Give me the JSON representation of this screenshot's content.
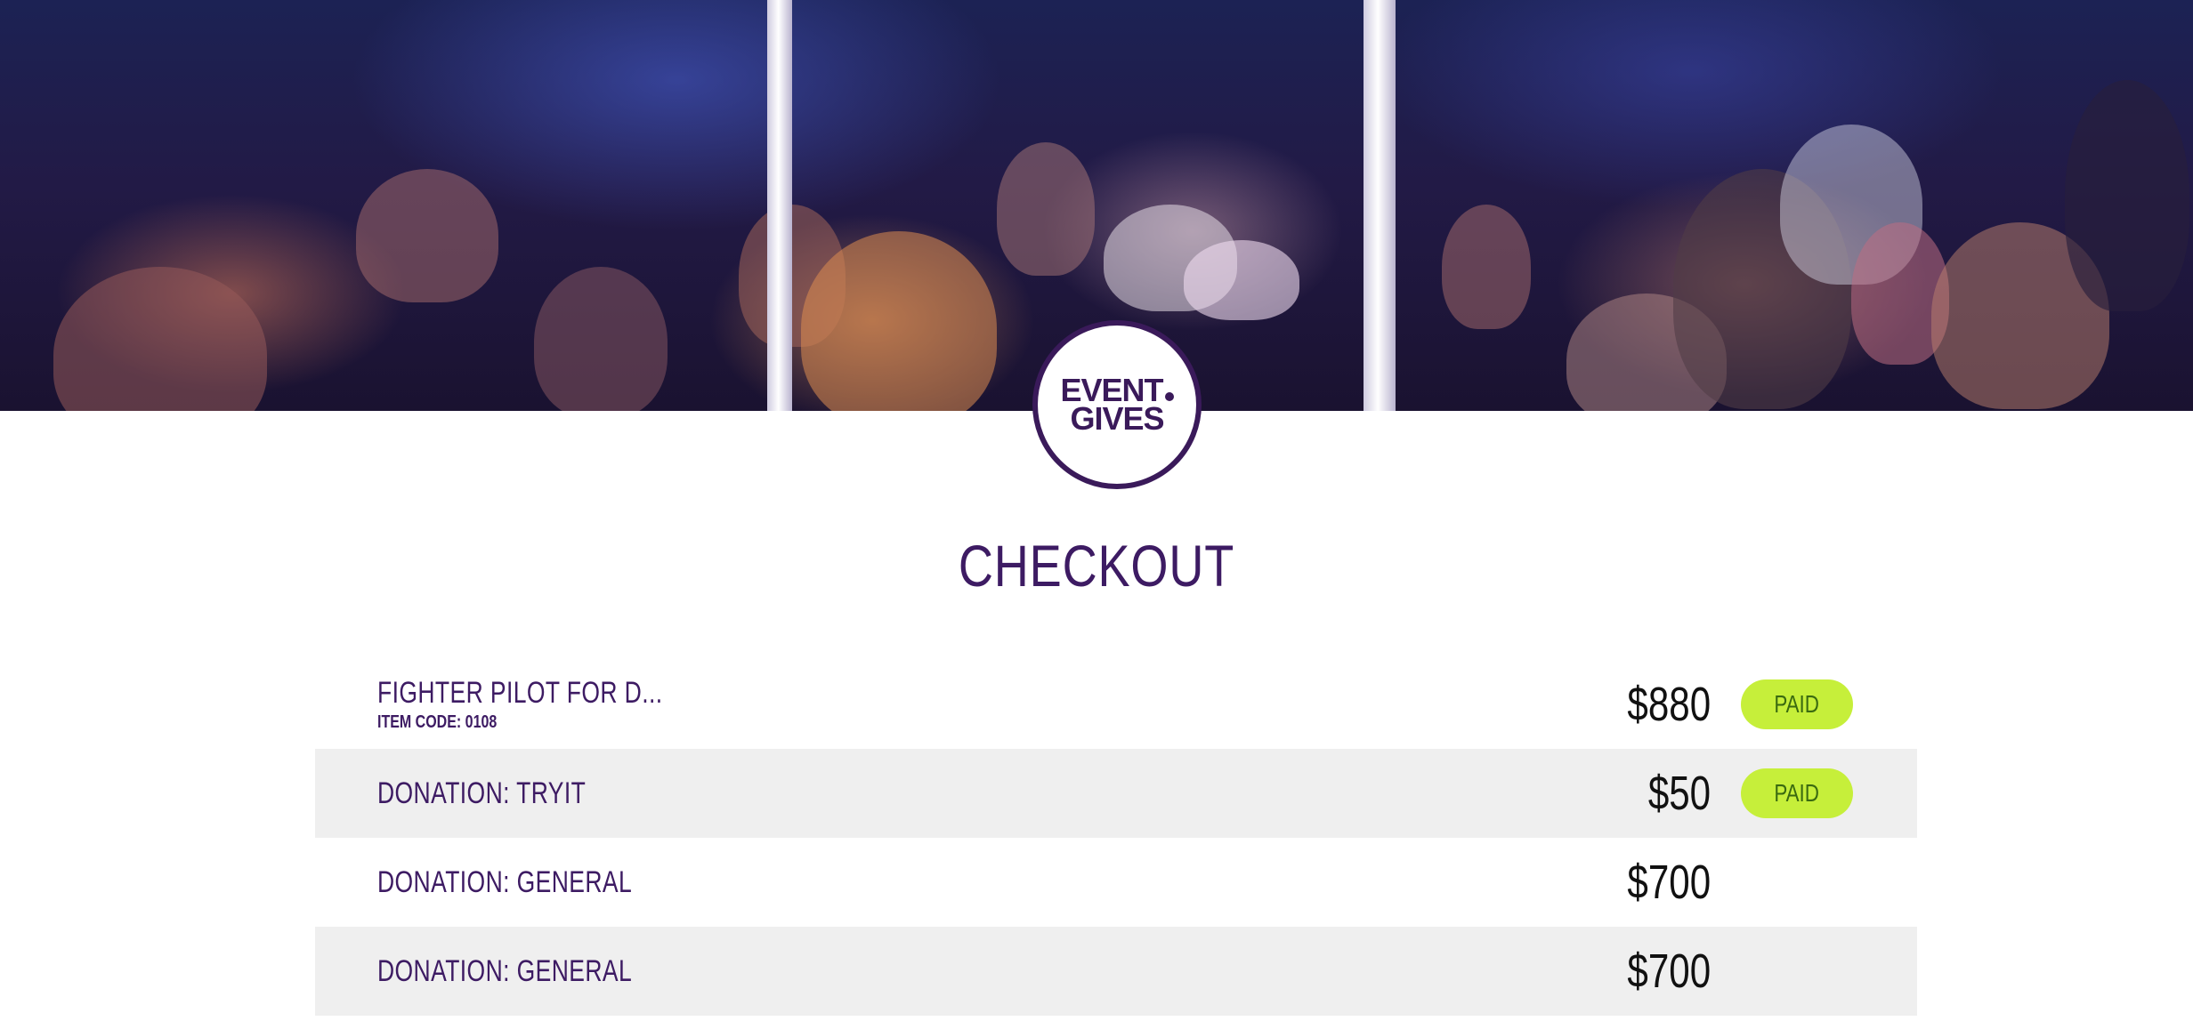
{
  "logo": {
    "line1": "EVENT",
    "line2": "GIVES"
  },
  "page_title": "CHECKOUT",
  "items": [
    {
      "name": "FIGHTER PILOT FOR D...",
      "code": "ITEM CODE: 0108",
      "price": "$880",
      "status": "PAID"
    },
    {
      "name": "DONATION: TRYIT",
      "price": "$50",
      "status": "PAID"
    },
    {
      "name": "DONATION: GENERAL",
      "price": "$700"
    },
    {
      "name": "DONATION: GENERAL",
      "price": "$700"
    }
  ],
  "colors": {
    "brand_purple": "#3d1b63",
    "paid_badge_bg": "#c6ef3a",
    "paid_badge_text": "#3a6a10",
    "row_shade": "#efefef"
  },
  "icons": {
    "hero": "event-crowd-photo"
  }
}
